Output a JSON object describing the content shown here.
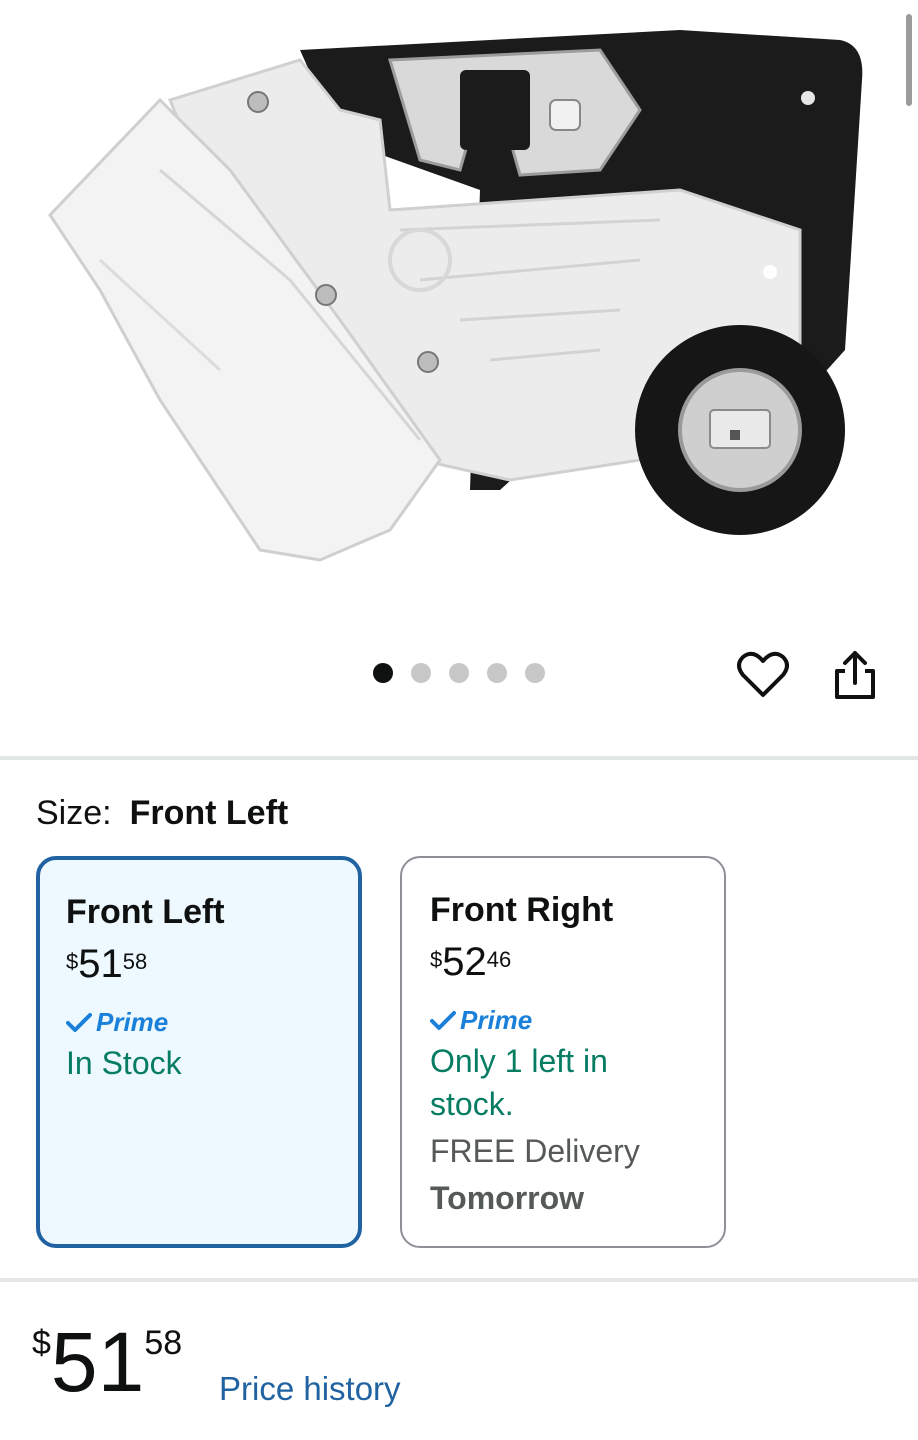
{
  "image": {
    "alt_icon": "door-lock-actuator-image",
    "carousel_dots": 5,
    "active_dot": 1
  },
  "actions": {
    "wishlist_icon": "heart-icon",
    "share_icon": "share-icon"
  },
  "size": {
    "label": "Size:",
    "selected_value": "Front Left"
  },
  "options": [
    {
      "title": "Front Left",
      "currency": "$",
      "price_whole": "51",
      "price_fraction": "58",
      "prime_label": "Prime",
      "stock": "In Stock",
      "selected": true
    },
    {
      "title": "Front Right",
      "currency": "$",
      "price_whole": "52",
      "price_fraction": "46",
      "prime_label": "Prime",
      "stock": "Only 1 left in stock.",
      "delivery": "FREE Delivery",
      "delivery_day": "Tomorrow",
      "selected": false
    }
  ],
  "main_price": {
    "currency": "$",
    "whole": "51",
    "fraction": "58",
    "history_link": "Price history"
  },
  "colors": {
    "selected_border": "#2162a1",
    "selected_bg": "#edf8ff",
    "in_stock": "#067d62",
    "prime": "#1a80d9",
    "link": "#2162a1"
  }
}
